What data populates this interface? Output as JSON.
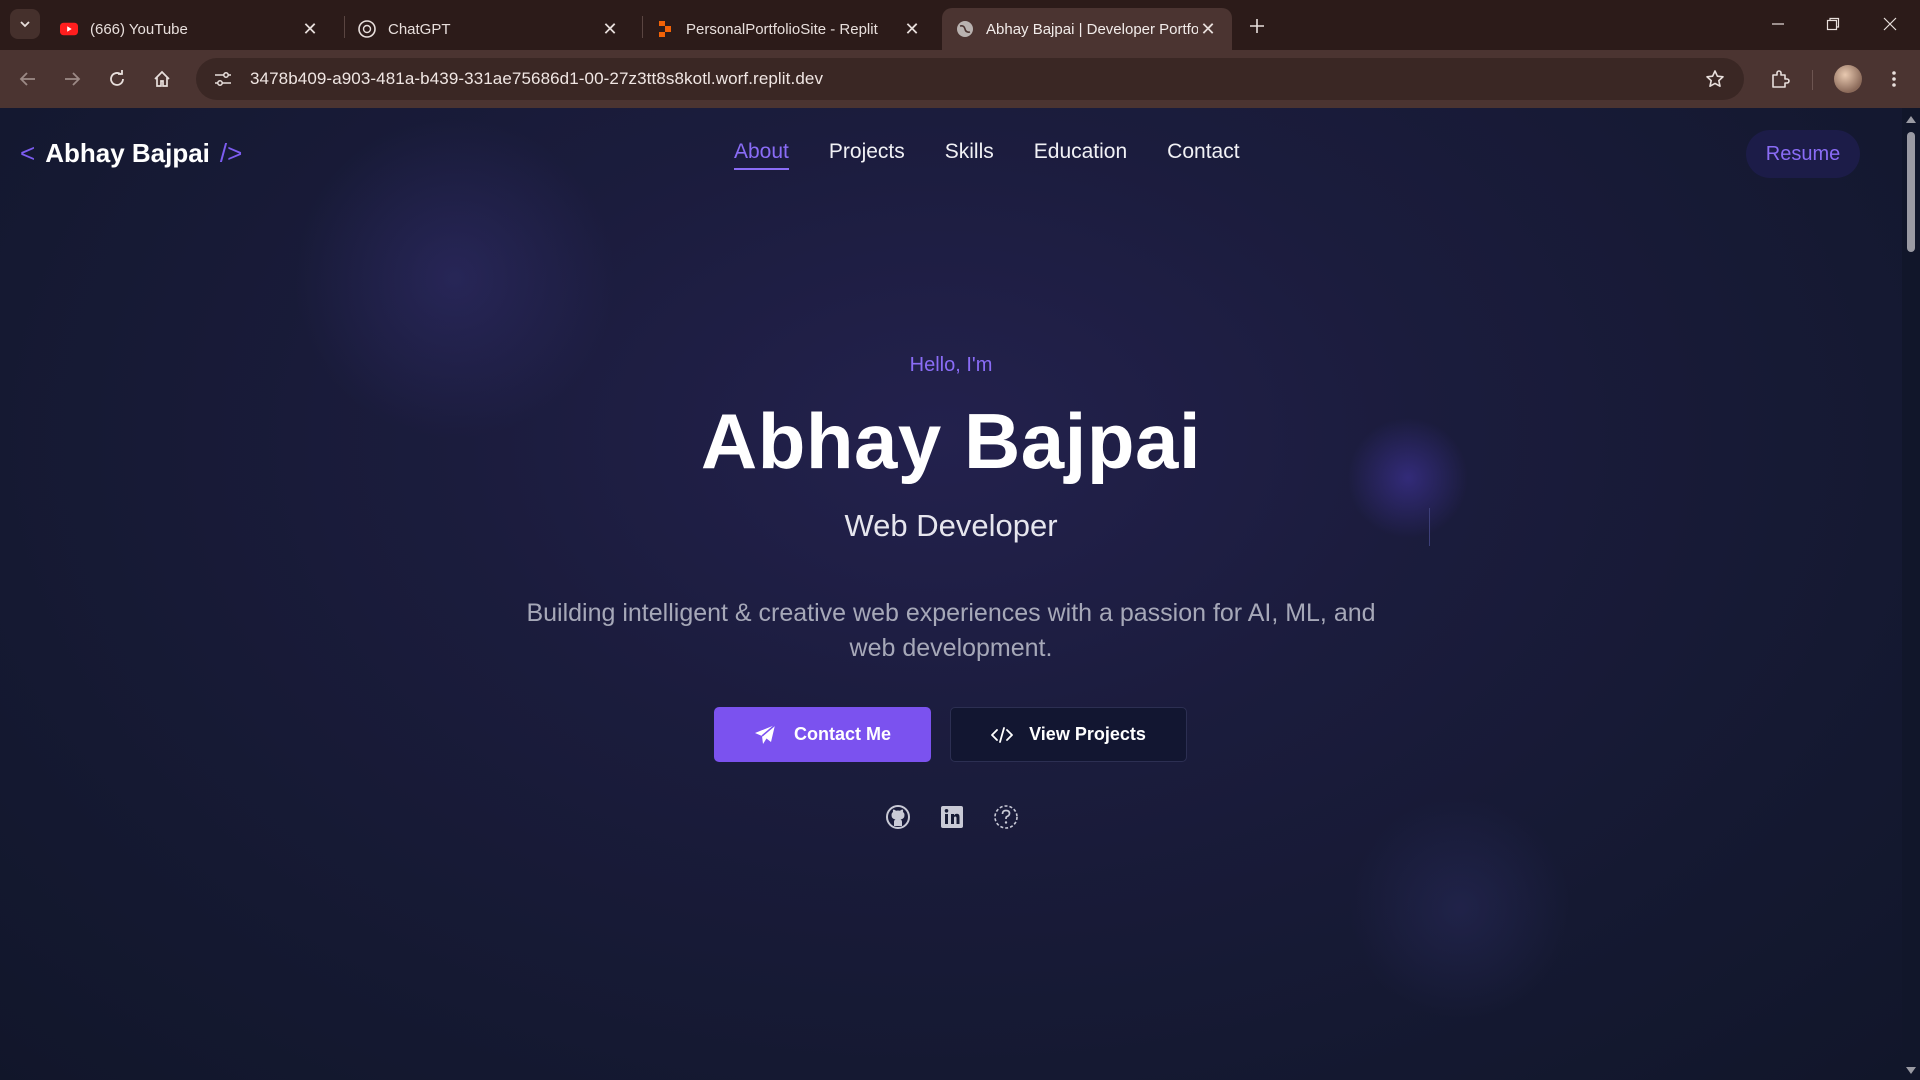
{
  "browser": {
    "tabs": [
      {
        "title": "(666) YouTube",
        "icon": "youtube-icon"
      },
      {
        "title": "ChatGPT",
        "icon": "chatgpt-icon"
      },
      {
        "title": "PersonalPortfolioSite - Replit",
        "icon": "replit-icon"
      },
      {
        "title": "Abhay Bajpai | Developer Portfolio",
        "icon": "globe-icon",
        "active": true
      }
    ],
    "url": "3478b409-a903-481a-b439-331ae75686d1-00-27z3tt8s8kotl.worf.replit.dev"
  },
  "header": {
    "logo_open": "<",
    "logo_name": "Abhay Bajpai",
    "logo_close": "/>",
    "nav": [
      "About",
      "Projects",
      "Skills",
      "Education",
      "Contact"
    ],
    "active_nav": "About",
    "resume_label": "Resume"
  },
  "hero": {
    "greeting": "Hello, I'm",
    "name": "Abhay Bajpai",
    "role": "Web Developer",
    "description": "Building intelligent & creative web experiences with a passion for AI, ML, and web development.",
    "primary_button": "Contact Me",
    "secondary_button": "View Projects",
    "social_icons": [
      "github-icon",
      "linkedin-icon",
      "question-icon"
    ]
  },
  "colors": {
    "accent": "#7b52ef",
    "accent_text": "#8a6cf6",
    "background": "#151932",
    "browser_frame": "#4b3431"
  }
}
